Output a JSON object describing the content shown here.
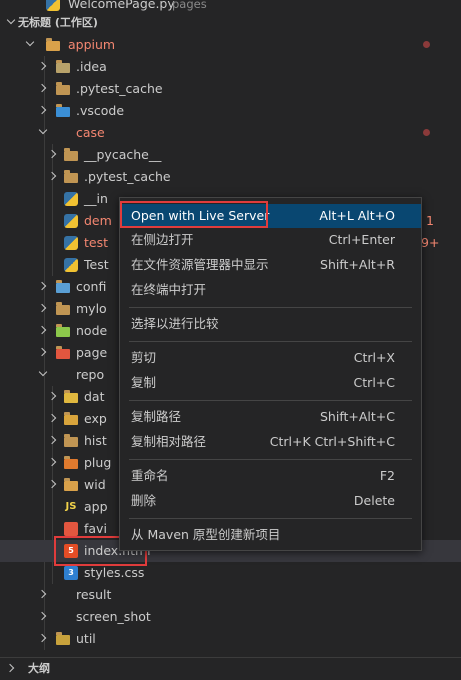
{
  "top_file": {
    "label": "WelcomePage.py",
    "suffix": "pages"
  },
  "workspace_title": "无标题 (工作区)",
  "tree": [
    {
      "label": "appium",
      "icon": "appium-folder-icon",
      "color": "#f48771",
      "open": true
    },
    {
      "label": ".idea",
      "icon": "idea-folder-icon",
      "color": "#cccccc"
    },
    {
      "label": ".pytest_cache",
      "icon": "folder-icon",
      "color": "#cccccc"
    },
    {
      "label": ".vscode",
      "icon": "vscode-folder-icon",
      "color": "#cccccc"
    },
    {
      "label": "case",
      "icon": "",
      "color": "#f48771",
      "open": true
    },
    {
      "label": "__pycache__",
      "icon": "folder-icon",
      "color": "#cccccc"
    },
    {
      "label": ".pytest_cache",
      "icon": "folder-icon",
      "color": "#cccccc"
    },
    {
      "label": "__in",
      "icon": "python-file-icon",
      "color": "#cccccc"
    },
    {
      "label": "dem",
      "icon": "python-file-icon",
      "color": "#f48771"
    },
    {
      "label": "test",
      "icon": "python-file-icon",
      "color": "#f48771"
    },
    {
      "label": "Test",
      "icon": "python-file-icon",
      "color": "#cccccc"
    },
    {
      "label": "confi",
      "icon": "config-folder-icon",
      "color": "#cccccc"
    },
    {
      "label": "mylo",
      "icon": "folder-icon",
      "color": "#cccccc"
    },
    {
      "label": "node",
      "icon": "node-folder-icon",
      "color": "#cccccc"
    },
    {
      "label": "page",
      "icon": "pages-folder-icon",
      "color": "#cccccc"
    },
    {
      "label": "repo",
      "icon": "",
      "color": "#cccccc",
      "open": true
    },
    {
      "label": "dat",
      "icon": "data-folder-icon",
      "color": "#cccccc"
    },
    {
      "label": "exp",
      "icon": "export-folder-icon",
      "color": "#cccccc"
    },
    {
      "label": "hist",
      "icon": "folder-icon",
      "color": "#cccccc"
    },
    {
      "label": "plug",
      "icon": "plugin-folder-icon",
      "color": "#cccccc"
    },
    {
      "label": "wid",
      "icon": "widget-folder-icon",
      "color": "#cccccc"
    },
    {
      "label": "app",
      "icon": "js-file-icon",
      "color": "#cccccc"
    },
    {
      "label": "favi",
      "icon": "favicon-file-icon",
      "color": "#cccccc"
    },
    {
      "label": "index.html",
      "icon": "html-file-icon",
      "color": "#cccccc"
    },
    {
      "label": "styles.css",
      "icon": "css-file-icon",
      "color": "#cccccc"
    },
    {
      "label": "result",
      "icon": "",
      "color": "#cccccc"
    },
    {
      "label": "screen_shot",
      "icon": "",
      "color": "#cccccc"
    },
    {
      "label": "util",
      "icon": "util-folder-icon",
      "color": "#cccccc"
    }
  ],
  "outline_title": "大纲",
  "edge_marks": {
    "dem": "1",
    "test": "9+"
  },
  "icon_letters": {
    "js": "JS",
    "html": "5",
    "css": "3"
  },
  "menu": [
    {
      "label": "Open with Live Server",
      "shortcut": "Alt+L Alt+O"
    },
    {
      "label": "在侧边打开",
      "shortcut": "Ctrl+Enter"
    },
    {
      "label": "在文件资源管理器中显示",
      "shortcut": "Shift+Alt+R"
    },
    {
      "label": "在终端中打开",
      "shortcut": ""
    },
    {
      "label": "选择以进行比较",
      "shortcut": ""
    },
    {
      "label": "剪切",
      "shortcut": "Ctrl+X"
    },
    {
      "label": "复制",
      "shortcut": "Ctrl+C"
    },
    {
      "label": "复制路径",
      "shortcut": "Shift+Alt+C"
    },
    {
      "label": "复制相对路径",
      "shortcut": "Ctrl+K Ctrl+Shift+C"
    },
    {
      "label": "重命名",
      "shortcut": "F2"
    },
    {
      "label": "删除",
      "shortcut": "Delete"
    },
    {
      "label": "从 Maven 原型创建新项目",
      "shortcut": ""
    }
  ],
  "colors": {
    "highlight": "#094771",
    "modified": "#f48771",
    "annotation": "#e03c3c"
  }
}
